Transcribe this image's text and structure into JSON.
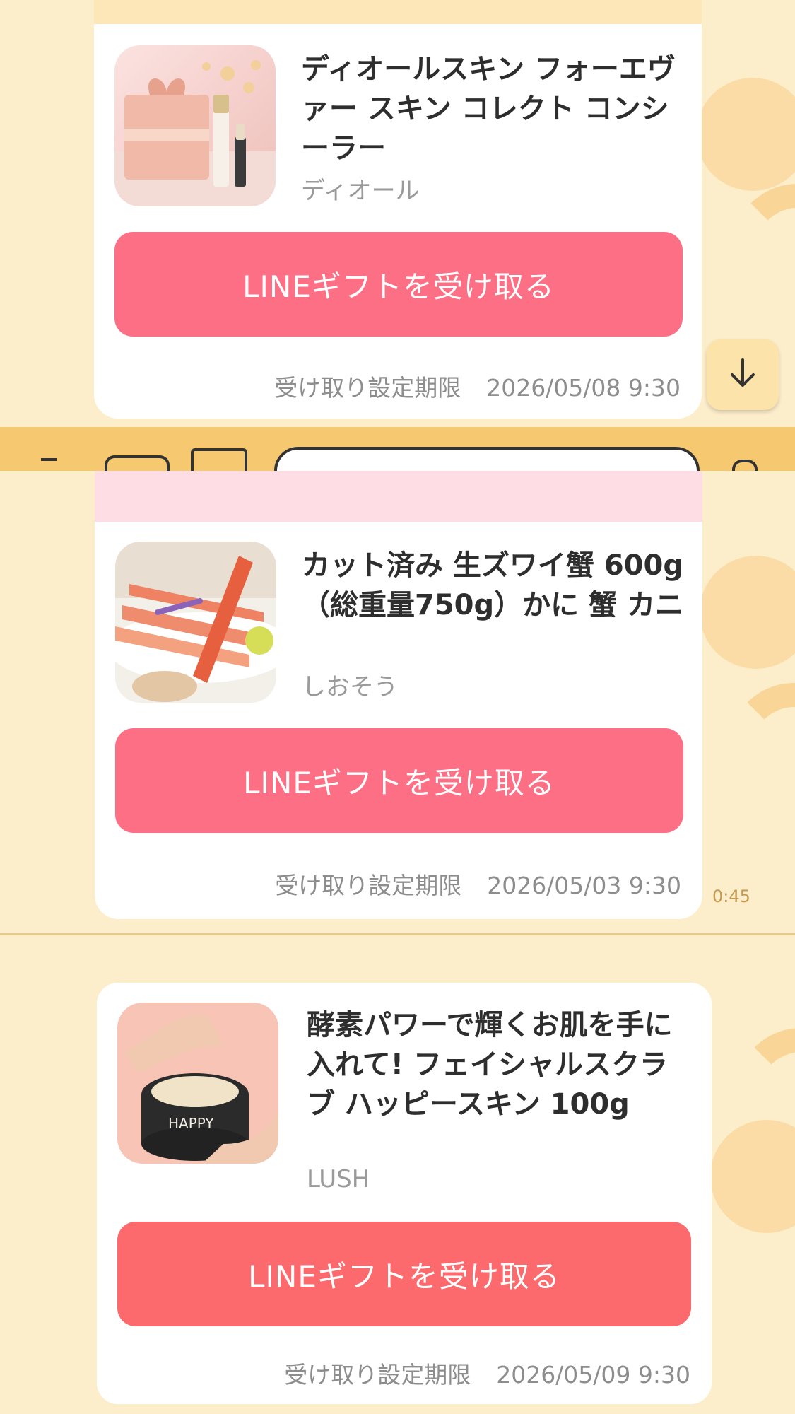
{
  "gifts": [
    {
      "title": "ディオールスキン フォーエヴァー スキン コレクト コンシーラー",
      "brand": "ディオール",
      "button_label": "LINEギフトを受け取る",
      "deadline_label": "受け取り設定期限",
      "deadline_date": "2026/05/08 9:30"
    },
    {
      "title": "カット済み 生ズワイ蟹 600g（総重量750g）かに 蟹 カニ",
      "brand": "しおそう",
      "button_label": "LINEギフトを受け取る",
      "deadline_label": "受け取り設定期限",
      "deadline_date": "2026/05/03 9:30",
      "sent_time": "0:45"
    },
    {
      "title": "酵素パワーで輝くお肌を手に入れて! フェイシャルスクラブ ハッピースキン 100g",
      "brand": "LUSH",
      "button_label": "LINEギフトを受け取る",
      "deadline_label": "受け取り設定期限",
      "deadline_date": "2026/05/09 9:30"
    }
  ],
  "colors": {
    "background": "#fdeecb",
    "button": "#fd6f84",
    "chat_bar": "#f6c86f"
  },
  "icons": {
    "scroll_down": "arrow-down-icon"
  }
}
